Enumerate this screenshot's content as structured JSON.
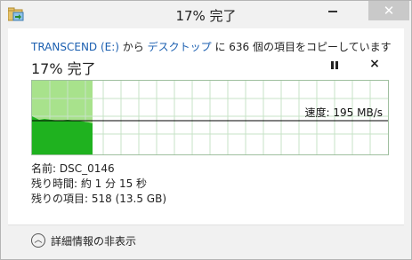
{
  "window": {
    "title": "17% 完了",
    "app_icon": "copy-folder-icon",
    "minimize_icon": "minimize-icon",
    "close_icon": "close-icon",
    "close_glyph": "✕"
  },
  "copy": {
    "source": "TRANSCEND (E:)",
    "from_text": " から ",
    "destination": "デスクトップ",
    "to_text": " に 636 個の項目をコピーしています"
  },
  "progress": {
    "title": "17% 完了",
    "pause_icon": "pause-icon",
    "cancel_icon": "cancel-icon",
    "cancel_glyph": "×",
    "fraction": 0.17
  },
  "graph": {
    "speed_text": "速度: 195 MB/s",
    "colors": {
      "done_light": "#a8e28c",
      "done_fill": "#1fb21f",
      "grid": "#c7e3c7",
      "line": "#000000"
    }
  },
  "details": {
    "name_label": "名前: ",
    "name_value": "DSC_0146",
    "time_label": "残り時間: ",
    "time_value": "約 1 分 15 秒",
    "items_label": "残りの項目: ",
    "items_value": "518 (13.5 GB)"
  },
  "footer": {
    "toggle_icon": "chevron-up-icon",
    "toggle_glyph": "︿",
    "toggle_label": "詳細情報の非表示"
  }
}
